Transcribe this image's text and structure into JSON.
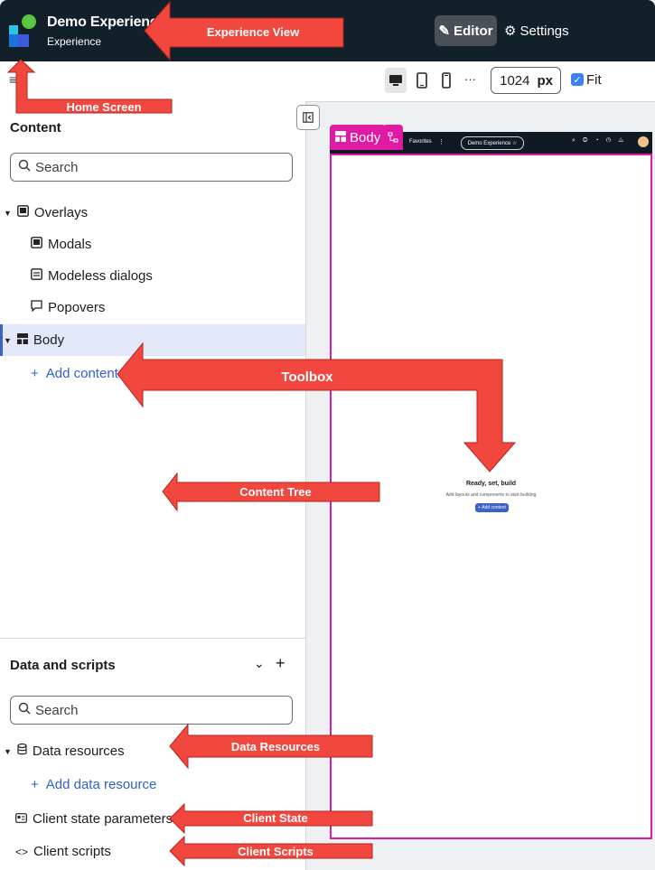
{
  "header": {
    "app_title": "Demo Experience",
    "app_subtitle": "Experience",
    "editor_label": "Editor",
    "settings_label": "Settings"
  },
  "toolbar": {
    "width_value": "1024",
    "width_unit": "px",
    "fit_label": "Fit",
    "more_label": "···"
  },
  "content_panel": {
    "title": "Content",
    "search_placeholder": "Search",
    "tree": {
      "overlays": "Overlays",
      "modals": "Modals",
      "modeless": "Modeless dialogs",
      "popovers": "Popovers",
      "body": "Body",
      "add_content": "Add content"
    }
  },
  "data_panel": {
    "title": "Data and scripts",
    "search_placeholder": "Search",
    "data_resources": "Data resources",
    "add_data_resource": "Add data resource",
    "client_state": "Client state parameters",
    "client_scripts": "Client scripts"
  },
  "canvas": {
    "body_tag": "Body",
    "preview_favorites": "Favorites",
    "preview_title": "Demo Experience ☆",
    "empty_title": "Ready, set, build",
    "empty_sub": "Add layouts and components to start building",
    "empty_button": "+ Add content"
  },
  "annotations": {
    "experience_view": "Experience View",
    "home_screen": "Home Screen",
    "toolbox": "Toolbox",
    "content_tree": "Content Tree",
    "data_resources": "Data Resources",
    "client_state": "Client State",
    "client_scripts": "Client Scripts"
  },
  "colors": {
    "header_bg": "#12202a",
    "accent_magenta": "#e01aa3",
    "link_blue": "#2f5fd0",
    "annotation_red": "#f2473f"
  }
}
